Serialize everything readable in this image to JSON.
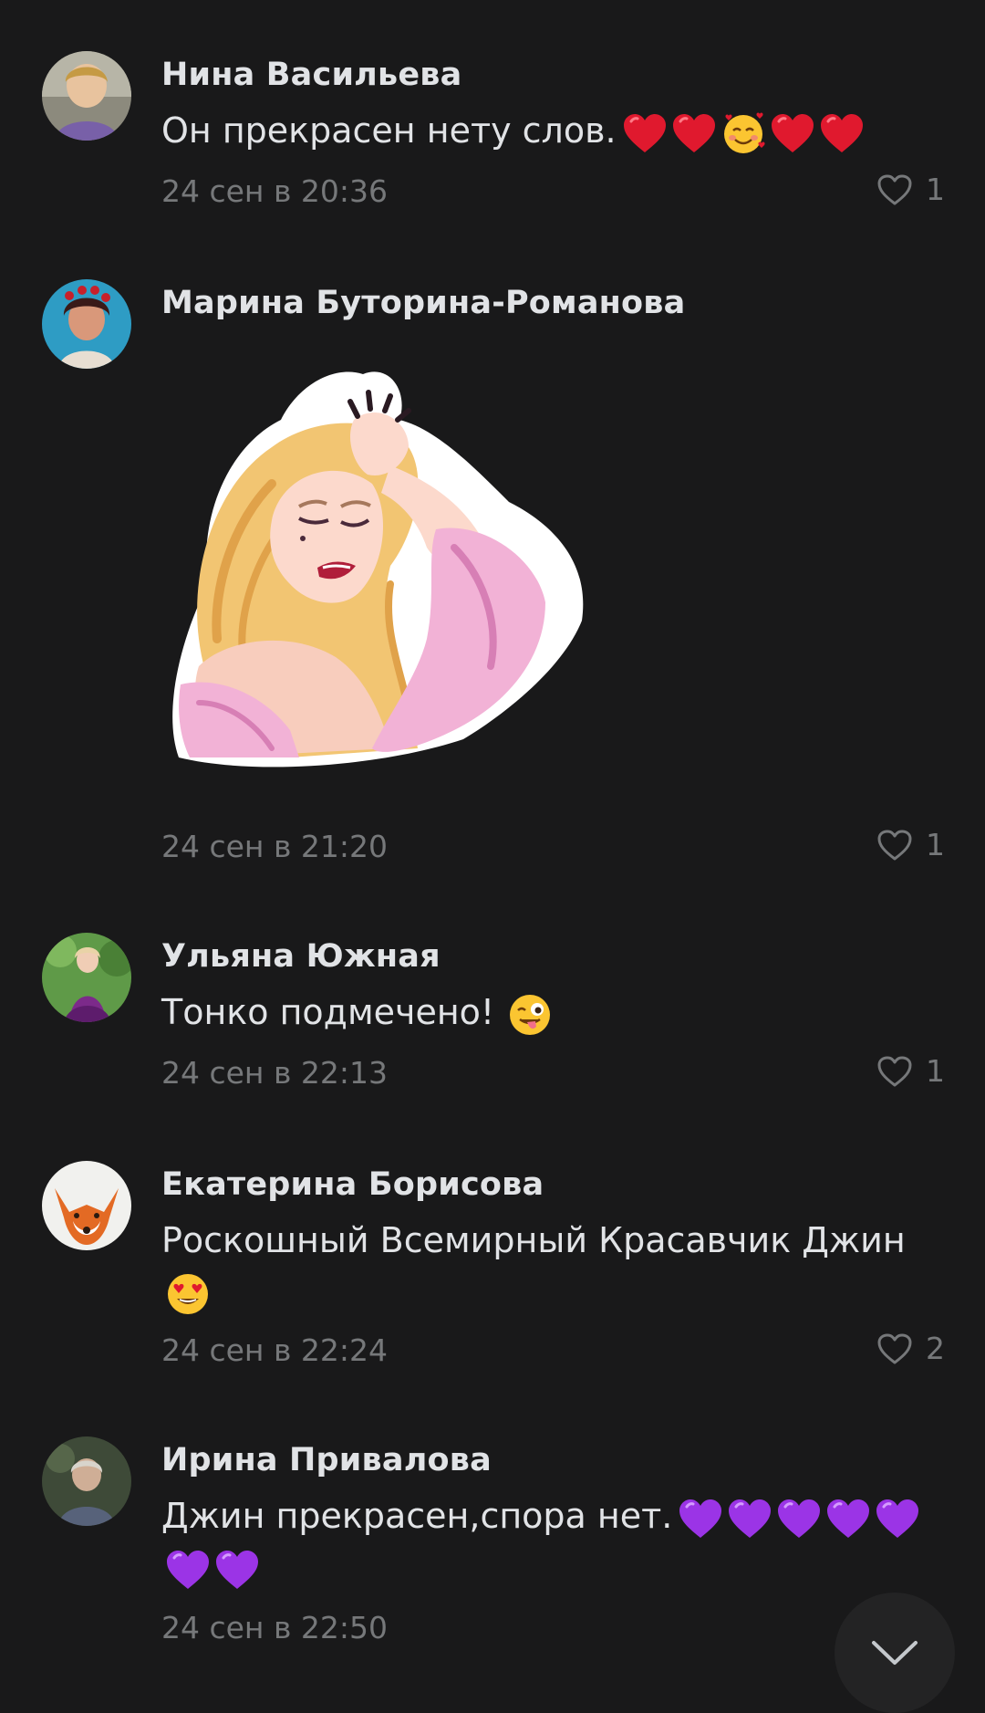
{
  "comments": [
    {
      "author": "Нина Васильева",
      "text": "Он  прекрасен нету слов.",
      "emojis": [
        "red-heart",
        "red-heart",
        "smiling-face-with-hearts",
        "red-heart",
        "red-heart"
      ],
      "date": "24 сен в 20:36",
      "likes": "1"
    },
    {
      "author": "Марина Буторина-Романова",
      "sticker": "sticker-blonde-woman-pink-robe",
      "date": "24 сен в 21:20",
      "likes": "1"
    },
    {
      "author": "Ульяна Южная",
      "text": "Тонко подмечено!",
      "emojis": [
        "winking-face-with-tongue"
      ],
      "date": "24 сен в 22:13",
      "likes": "1"
    },
    {
      "author": "Екатерина Борисова",
      "text": "Роскошный Всемирный Красавчик Джин",
      "emojis": [
        "smiling-face-with-heart-eyes"
      ],
      "date": "24 сен в 22:24",
      "likes": "2"
    },
    {
      "author": "Ирина Привалова",
      "text": "Джин прекрасен,спора нет.",
      "emojis": [
        "purple-heart",
        "purple-heart",
        "purple-heart",
        "purple-heart",
        "purple-heart",
        "purple-heart",
        "purple-heart"
      ],
      "date": "24 сен в 22:50"
    }
  ],
  "colors": {
    "background": "#19191a",
    "text": "#e1e3e6",
    "secondary": "#76787a"
  }
}
